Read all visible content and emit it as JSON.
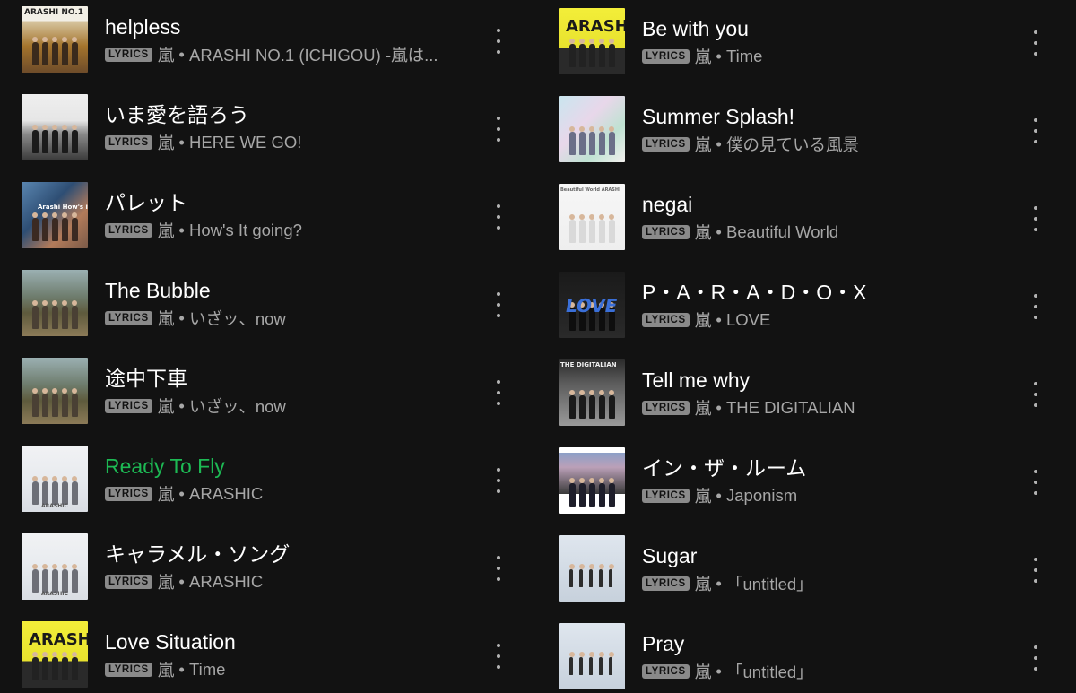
{
  "badge_label": "LYRICS",
  "accent_color": "#1db954",
  "left_tracks": [
    {
      "title": "helpless",
      "artist": "嵐",
      "album": "ARASHI NO.1 (ICHIGOU) -嵐は...",
      "cover": "arashi-no1",
      "active": false
    },
    {
      "title": "いま愛を語ろう",
      "artist": "嵐",
      "album": "HERE WE GO!",
      "cover": "here-we-go",
      "active": false
    },
    {
      "title": "パレット",
      "artist": "嵐",
      "album": "How's It going?",
      "cover": "hows-it-going",
      "active": false
    },
    {
      "title": "The Bubble",
      "artist": "嵐",
      "album": "いざッ、now",
      "cover": "iza-now",
      "active": false
    },
    {
      "title": "途中下車",
      "artist": "嵐",
      "album": "いざッ、now",
      "cover": "iza-now",
      "active": false
    },
    {
      "title": "Ready To Fly",
      "artist": "嵐",
      "album": "ARASHIC",
      "cover": "arashic",
      "active": true
    },
    {
      "title": "キャラメル・ソング",
      "artist": "嵐",
      "album": "ARASHIC",
      "cover": "arashic",
      "active": false
    },
    {
      "title": "Love Situation",
      "artist": "嵐",
      "album": "Time",
      "cover": "time",
      "active": false
    }
  ],
  "right_tracks": [
    {
      "title": "Be with you",
      "artist": "嵐",
      "album": "Time",
      "cover": "time",
      "active": false
    },
    {
      "title": "Summer Splash!",
      "artist": "嵐",
      "album": "僕の見ている風景",
      "cover": "boku-no-fukei",
      "active": false
    },
    {
      "title": "negai",
      "artist": "嵐",
      "album": "Beautiful World",
      "cover": "beautiful-world",
      "active": false
    },
    {
      "title": "P・A・R・A・D・O・X",
      "artist": "嵐",
      "album": "LOVE",
      "cover": "love",
      "active": false
    },
    {
      "title": "Tell me why",
      "artist": "嵐",
      "album": "THE DIGITALIAN",
      "cover": "digitalian",
      "active": false
    },
    {
      "title": "イン・ザ・ルーム",
      "artist": "嵐",
      "album": "Japonism",
      "cover": "japonism",
      "active": false
    },
    {
      "title": "Sugar",
      "artist": "嵐",
      "album": "「untitled」",
      "cover": "untitled",
      "active": false
    },
    {
      "title": "Pray",
      "artist": "嵐",
      "album": "「untitled」",
      "cover": "untitled",
      "active": false
    }
  ],
  "cover_text": {
    "arashi-no1": "ARASHI  NO.1",
    "hows-it-going": "Arashi How's it going?",
    "iza-now": "",
    "arashic": "ARASHIC",
    "time": "ARASHI",
    "boku-no-fukei": "",
    "beautiful-world": "Beautiful World ARASHI",
    "love": "LOVE",
    "digitalian": "THE DIGITALIAN",
    "japonism": "",
    "untitled": "",
    "here-we-go": ""
  }
}
